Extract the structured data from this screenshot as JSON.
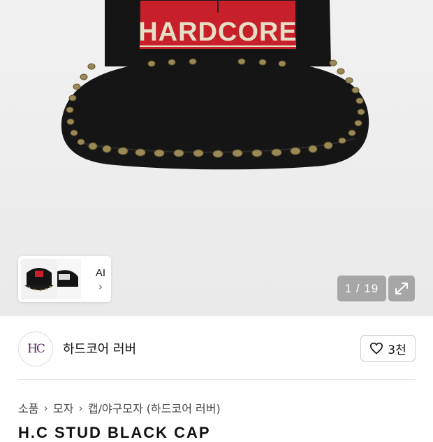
{
  "hero": {
    "product_text": "HARDCORE",
    "counter": "1 / 19",
    "ai_label": "AI",
    "ai_chevron": "›"
  },
  "seller": {
    "avatar_text": "HC",
    "name": "하드코어 러버",
    "like_count": "3천"
  },
  "breadcrumb": {
    "items": [
      "소품",
      "모자",
      "캡/야구모자 (하드코어 러버)"
    ],
    "separator": "›"
  },
  "product": {
    "title": "H.C STUD BLACK CAP"
  },
  "colors": {
    "accent_red": "#c8202a",
    "cap_black": "#151515",
    "stud_gold": "#9b8a55",
    "embroidery": "#e6dfc6"
  }
}
